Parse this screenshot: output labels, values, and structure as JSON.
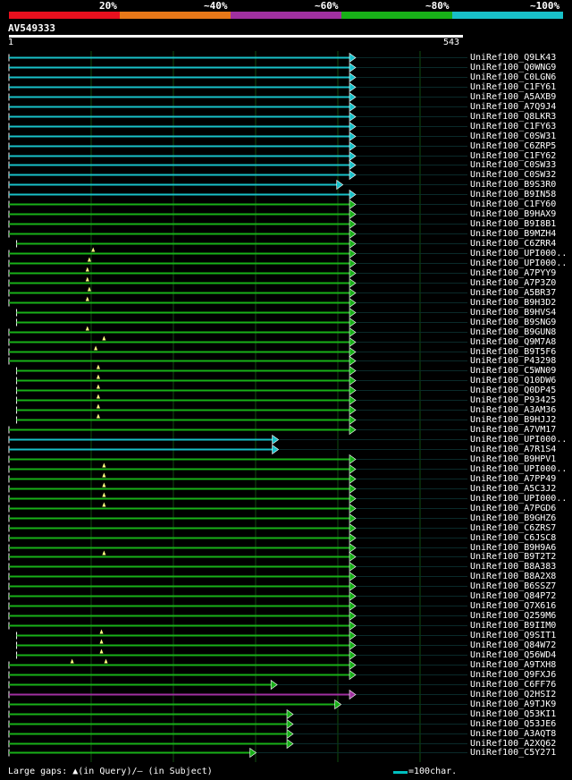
{
  "colors": {
    "red": "#e8101e",
    "orange": "#e87818",
    "purple": "#a030a0",
    "green": "#18b018",
    "cyan": "#18c0c8",
    "gap_marker": "#ffff80",
    "line": "#ffffff",
    "grid": "#0f4d0f"
  },
  "legend": [
    {
      "label": "20%",
      "color": "red"
    },
    {
      "label": "~40%",
      "color": "orange"
    },
    {
      "label": "~60%",
      "color": "purple"
    },
    {
      "label": "~80%",
      "color": "green"
    },
    {
      "label": "~100%",
      "color": "cyan"
    }
  ],
  "query": {
    "name": "AV549333",
    "start": "1",
    "end": "543"
  },
  "hits": [
    {
      "name": "UniRef100_Q9LK43",
      "color": "cyan",
      "start": 1,
      "end": 543,
      "arrow_left": false
    },
    {
      "name": "UniRef100_Q0WNG9",
      "color": "cyan",
      "start": 1,
      "end": 543
    },
    {
      "name": "UniRef100_C0LGN6",
      "color": "cyan",
      "start": 1,
      "end": 543
    },
    {
      "name": "UniRef100_C1FY61",
      "color": "cyan",
      "start": 1,
      "end": 543
    },
    {
      "name": "UniRef100_A5AXB9",
      "color": "cyan",
      "start": 1,
      "end": 543
    },
    {
      "name": "UniRef100_A7Q9J4",
      "color": "cyan",
      "start": 1,
      "end": 543
    },
    {
      "name": "UniRef100_Q8LKR3",
      "color": "cyan",
      "start": 1,
      "end": 543
    },
    {
      "name": "UniRef100_C1FY63",
      "color": "cyan",
      "start": 1,
      "end": 543
    },
    {
      "name": "UniRef100_C0SW31",
      "color": "cyan",
      "start": 1,
      "end": 543
    },
    {
      "name": "UniRef100_C6ZRP5",
      "color": "cyan",
      "start": 1,
      "end": 543
    },
    {
      "name": "UniRef100_C1FY62",
      "color": "cyan",
      "start": 1,
      "end": 543
    },
    {
      "name": "UniRef100_C0SW33",
      "color": "cyan",
      "start": 1,
      "end": 543
    },
    {
      "name": "UniRef100_C0SW32",
      "color": "cyan",
      "start": 1,
      "end": 543
    },
    {
      "name": "UniRef100_B9S3R0",
      "color": "cyan",
      "start": 1,
      "end": 523
    },
    {
      "name": "UniRef100_B9IN58",
      "color": "cyan",
      "start": 1,
      "end": 543
    },
    {
      "name": "UniRef100_C1FY60",
      "color": "green",
      "start": 1,
      "end": 543
    },
    {
      "name": "UniRef100_B9HAX9",
      "color": "green",
      "start": 1,
      "end": 543
    },
    {
      "name": "UniRef100_B9I8B1",
      "color": "green",
      "start": 1,
      "end": 543
    },
    {
      "name": "UniRef100_B9MZH4",
      "color": "green",
      "start": 1,
      "end": 543
    },
    {
      "name": "UniRef100_C6ZRR4",
      "color": "green",
      "start": 13,
      "end": 543
    },
    {
      "name": "UniRef100_UPI000..",
      "color": "green",
      "start": 1,
      "end": 543,
      "gap": 133
    },
    {
      "name": "UniRef100_UPI000..",
      "color": "green",
      "start": 1,
      "end": 543,
      "gap": 127
    },
    {
      "name": "UniRef100_A7PYY9",
      "color": "green",
      "start": 1,
      "end": 543,
      "gap": 124
    },
    {
      "name": "UniRef100_A7P3Z0",
      "color": "green",
      "start": 1,
      "end": 543,
      "gap": 124
    },
    {
      "name": "UniRef100_A5BR37",
      "color": "green",
      "start": 1,
      "end": 543,
      "gap": 127
    },
    {
      "name": "UniRef100_B9H3D2",
      "color": "green",
      "start": 1,
      "end": 543,
      "gap": 124
    },
    {
      "name": "UniRef100_B9HVS4",
      "color": "green",
      "start": 13,
      "end": 543
    },
    {
      "name": "UniRef100_B9SNG9",
      "color": "green",
      "start": 13,
      "end": 543
    },
    {
      "name": "UniRef100_B9GUN8",
      "color": "green",
      "start": 1,
      "end": 543,
      "gap": 124
    },
    {
      "name": "UniRef100_Q9M7A8",
      "color": "green",
      "start": 1,
      "end": 543,
      "gap": 150
    },
    {
      "name": "UniRef100_B9T5F6",
      "color": "green",
      "start": 1,
      "end": 543,
      "gap": 137
    },
    {
      "name": "UniRef100_P43298",
      "color": "green",
      "start": 1,
      "end": 543
    },
    {
      "name": "UniRef100_C5WN09",
      "color": "green",
      "start": 13,
      "end": 543,
      "gap": 141
    },
    {
      "name": "UniRef100_Q10DW6",
      "color": "green",
      "start": 13,
      "end": 543,
      "gap": 141
    },
    {
      "name": "UniRef100_Q0DP45",
      "color": "green",
      "start": 13,
      "end": 543,
      "gap": 141
    },
    {
      "name": "UniRef100_P93425",
      "color": "green",
      "start": 13,
      "end": 543,
      "gap": 141
    },
    {
      "name": "UniRef100_A3AM36",
      "color": "green",
      "start": 13,
      "end": 543,
      "gap": 141
    },
    {
      "name": "UniRef100_B9HJJ2",
      "color": "green",
      "start": 13,
      "end": 543,
      "gap": 141
    },
    {
      "name": "UniRef100_A7VM17",
      "color": "green",
      "start": 1,
      "end": 543
    },
    {
      "name": "UniRef100_UPI000..",
      "color": "cyan",
      "start": 1,
      "end": 422
    },
    {
      "name": "UniRef100_A7R1S4",
      "color": "cyan",
      "start": 1,
      "end": 422
    },
    {
      "name": "UniRef100_B9HPV1",
      "color": "green",
      "start": 1,
      "end": 543
    },
    {
      "name": "UniRef100_UPI000..",
      "color": "green",
      "start": 1,
      "end": 543,
      "gap": 150
    },
    {
      "name": "UniRef100_A7PP49",
      "color": "green",
      "start": 1,
      "end": 543,
      "gap": 150
    },
    {
      "name": "UniRef100_A5C3J2",
      "color": "green",
      "start": 1,
      "end": 543,
      "gap": 150
    },
    {
      "name": "UniRef100_UPI000..",
      "color": "green",
      "start": 1,
      "end": 543,
      "gap": 150
    },
    {
      "name": "UniRef100_A7PGD6",
      "color": "green",
      "start": 1,
      "end": 543,
      "gap": 150
    },
    {
      "name": "UniRef100_B9GHZ6",
      "color": "green",
      "start": 1,
      "end": 543
    },
    {
      "name": "UniRef100_C6ZRS7",
      "color": "green",
      "start": 1,
      "end": 543
    },
    {
      "name": "UniRef100_C6JSC8",
      "color": "green",
      "start": 1,
      "end": 543
    },
    {
      "name": "UniRef100_B9H9A6",
      "color": "green",
      "start": 1,
      "end": 543
    },
    {
      "name": "UniRef100_B9T2T2",
      "color": "green",
      "start": 1,
      "end": 543,
      "gap": 150
    },
    {
      "name": "UniRef100_B8A383",
      "color": "green",
      "start": 1,
      "end": 543
    },
    {
      "name": "UniRef100_B8A2X8",
      "color": "green",
      "start": 1,
      "end": 543
    },
    {
      "name": "UniRef100_B6SSZ7",
      "color": "green",
      "start": 1,
      "end": 543
    },
    {
      "name": "UniRef100_Q84P72",
      "color": "green",
      "start": 1,
      "end": 543
    },
    {
      "name": "UniRef100_Q7X616",
      "color": "green",
      "start": 1,
      "end": 543
    },
    {
      "name": "UniRef100_Q259M6",
      "color": "green",
      "start": 1,
      "end": 543
    },
    {
      "name": "UniRef100_B9IIM0",
      "color": "green",
      "start": 1,
      "end": 543
    },
    {
      "name": "UniRef100_Q9SIT1",
      "color": "green",
      "start": 13,
      "end": 543,
      "gap": 146
    },
    {
      "name": "UniRef100_Q84W72",
      "color": "green",
      "start": 13,
      "end": 543,
      "gap": 146
    },
    {
      "name": "UniRef100_Q56WD4",
      "color": "green",
      "start": 13,
      "end": 543,
      "gap": 146
    },
    {
      "name": "UniRef100_A9TXH8",
      "color": "green",
      "start": 1,
      "end": 543,
      "gap": 100,
      "gap2": 153
    },
    {
      "name": "UniRef100_Q9FXJ6",
      "color": "green",
      "start": 1,
      "end": 543
    },
    {
      "name": "UniRef100_C6FF76",
      "color": "green",
      "start": 1,
      "end": 420
    },
    {
      "name": "UniRef100_Q2HSI2",
      "color": "purple",
      "start": 1,
      "end": 543
    },
    {
      "name": "UniRef100_A9TJK9",
      "color": "green",
      "start": 1,
      "end": 520
    },
    {
      "name": "UniRef100_Q53KI1",
      "color": "green",
      "start": 1,
      "end": 445
    },
    {
      "name": "UniRef100_Q53JE6",
      "color": "green",
      "start": 1,
      "end": 445
    },
    {
      "name": "UniRef100_A3AQT8",
      "color": "green",
      "start": 1,
      "end": 445
    },
    {
      "name": "UniRef100_A2XQ62",
      "color": "green",
      "start": 1,
      "end": 445
    },
    {
      "name": "UniRef100_C5Y271",
      "color": "green",
      "start": 1,
      "end": 387
    }
  ],
  "footer": {
    "gaps_label": "Large gaps: ▲(in Query)/– (in Subject)",
    "scale_label": "=100char."
  }
}
